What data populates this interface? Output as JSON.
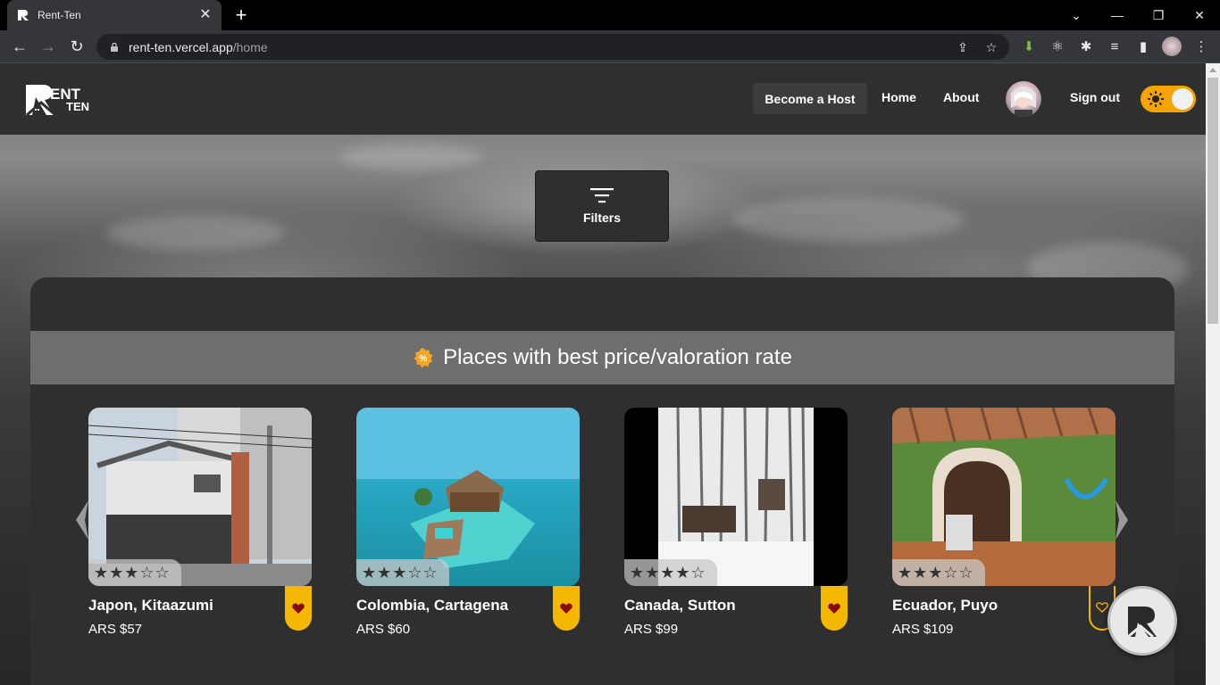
{
  "browser": {
    "tab_title": "Rent-Ten",
    "url_host": "rent-ten.vercel.app",
    "url_path": "/home",
    "new_tab_icon": "plus-icon"
  },
  "header": {
    "logo_text": "RENT TEN",
    "nav": {
      "become_host": "Become a Host",
      "home": "Home",
      "about": "About",
      "sign_out": "Sign out"
    },
    "theme_toggle": "sun-icon"
  },
  "filters": {
    "label": "Filters"
  },
  "section": {
    "title": "Places with best price/valoration rate"
  },
  "listings": [
    {
      "name": "Japon, Kitaazumi",
      "price": "ARS $57",
      "rating": 3,
      "favorited": true
    },
    {
      "name": "Colombia, Cartagena",
      "price": "ARS $60",
      "rating": 3,
      "favorited": true
    },
    {
      "name": "Canada, Sutton",
      "price": "ARS $99",
      "rating": 4,
      "favorited": true
    },
    {
      "name": "Ecuador, Puyo",
      "price": "ARS $109",
      "rating": 3,
      "favorited": false
    }
  ],
  "colors": {
    "accent": "#f5b800",
    "header_bg": "#2f2f2f",
    "section_bg": "#6e6e6e",
    "toggle": "#f5a400"
  }
}
